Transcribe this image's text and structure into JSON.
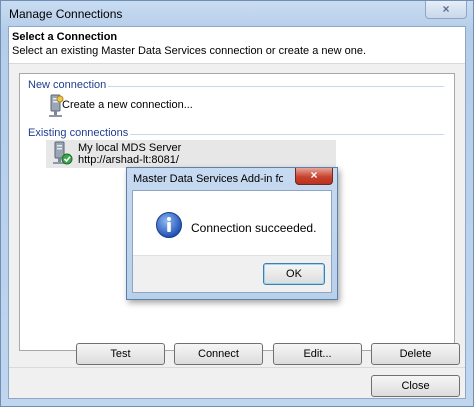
{
  "window": {
    "title": "Manage Connections",
    "close_glyph": "×"
  },
  "header": {
    "title": "Select a Connection",
    "subtitle": "Select an existing Master Data Services connection or create a new one."
  },
  "list": {
    "new_group_label": "New connection",
    "new_item_label": "Create a new connection...",
    "new_item_icon": "server-add-icon",
    "existing_group_label": "Existing connections",
    "existing_items": [
      {
        "name": "My local MDS Server",
        "url": "http://arshad-lt:8081/",
        "icon": "server-connected-icon"
      }
    ]
  },
  "buttons": {
    "test": "Test",
    "connect": "Connect",
    "edit": "Edit...",
    "delete": "Delete",
    "close": "Close"
  },
  "dialog": {
    "title": "Master Data Services Add-in for Exc...",
    "close_glyph": "×",
    "message": "Connection succeeded.",
    "ok": "OK",
    "icon": "info-icon"
  },
  "colors": {
    "accent": "#1e3f8f",
    "close_red": "#c8432f",
    "info_blue": "#2a64c8"
  }
}
